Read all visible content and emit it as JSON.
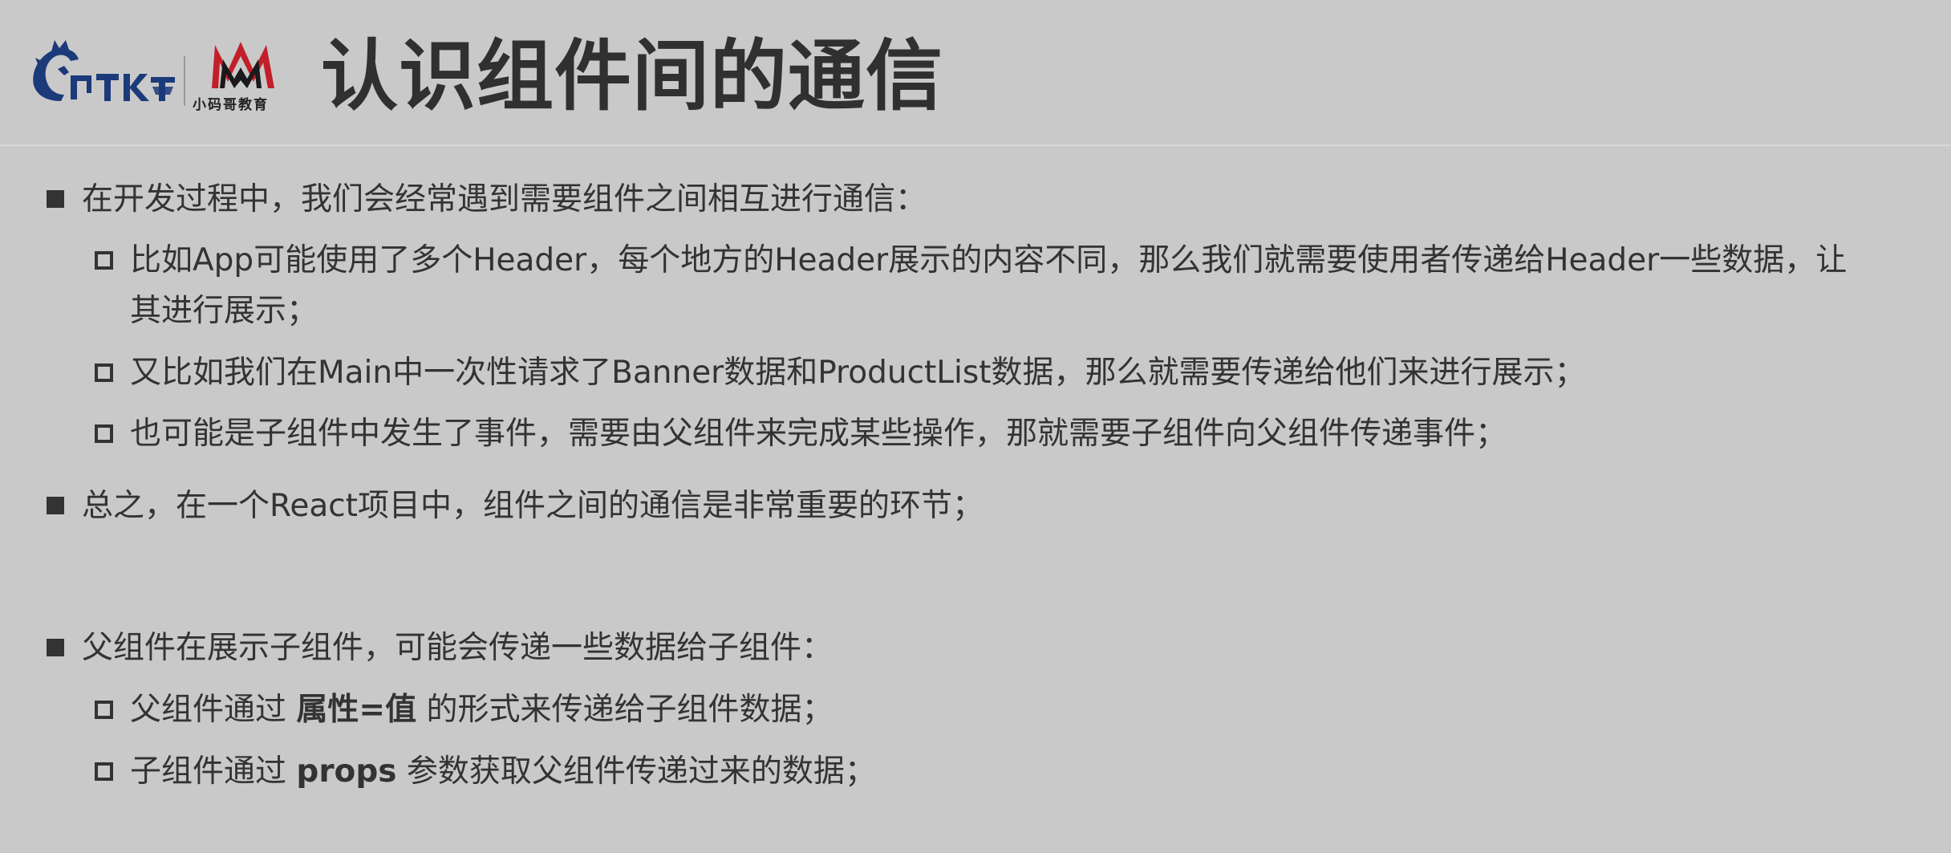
{
  "header": {
    "title": "认识组件间的通信",
    "logos": [
      {
        "name": "wolf-logo",
        "alt": "coderwhy wolf logo"
      },
      {
        "name": "xiaomage-logo",
        "text": "小码哥教育"
      }
    ]
  },
  "content": {
    "s1": {
      "text": "在开发过程中，我们会经常遇到需要组件之间相互进行通信：",
      "sub": [
        "比如App可能使用了多个Header，每个地方的Header展示的内容不同，那么我们就需要使用者传递给Header一些数据，让",
        "其进行展示；",
        "又比如我们在Main中一次性请求了Banner数据和ProductList数据，那么就需要传递给他们来进行展示；",
        "也可能是子组件中发生了事件，需要由父组件来完成某些操作，那就需要子组件向父组件传递事件；"
      ]
    },
    "s2": {
      "text": "总之，在一个React项目中，组件之间的通信是非常重要的环节；"
    },
    "s3": {
      "text": "父组件在展示子组件，可能会传递一些数据给子组件：",
      "sub1": {
        "pre": "父组件通过 ",
        "bold": "属性=值",
        "post": " 的形式来传递给子组件数据；"
      },
      "sub2": {
        "pre": "子组件通过 ",
        "bold": "props",
        "post": " 参数获取父组件传递过来的数据；"
      }
    }
  },
  "colors": {
    "background": "#c9c9c9",
    "text": "#333333",
    "logo_blue": "#1b3a7a",
    "logo_red": "#c21f2a"
  }
}
